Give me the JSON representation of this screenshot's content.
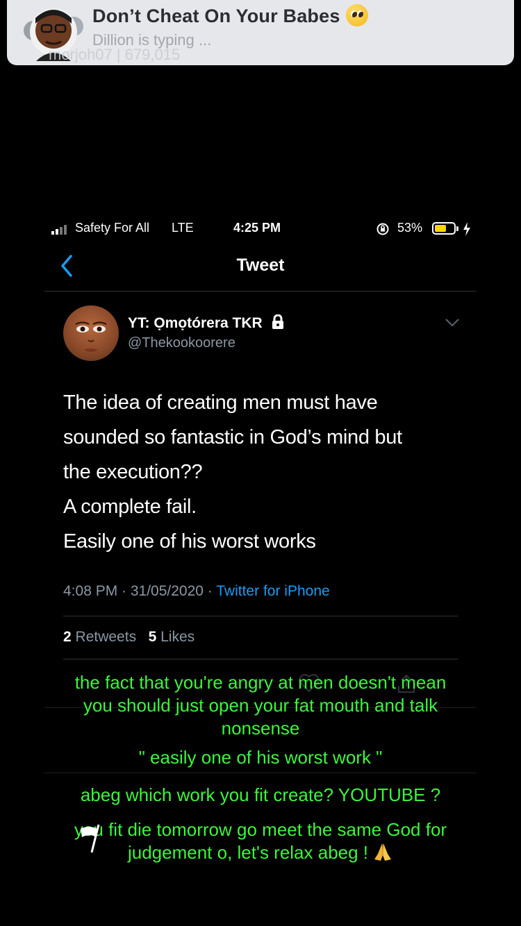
{
  "banner": {
    "title": "Don’t Cheat On Your Babes",
    "title_emoji": "pleading-face-emoji",
    "typing": "Dillion is typing ...",
    "ghost_text": "morjoh07 | 679,015"
  },
  "status_bar": {
    "carrier": "Safety For All",
    "network": "LTE",
    "time": "4:25 PM",
    "battery": "53%",
    "battery_level": 0.53
  },
  "nav": {
    "title": "Tweet"
  },
  "tweet": {
    "display_name": "YT: Ọmọtórera TKR",
    "handle": "@Thekookoorere",
    "lines": [
      "The idea of creating men must have",
      "sounded so fantastic in God’s mind but",
      "the execution??",
      "A complete fail.",
      "Easily one of his worst works"
    ],
    "timestamp": "4:08 PM · 31/05/2020 · ",
    "source": "Twitter for iPhone",
    "retweets_count": "2",
    "retweets_label": "Retweets",
    "likes_count": "5",
    "likes_label": "Likes"
  },
  "captions": {
    "c1": [
      "the fact that you're angry at men doesn't mean",
      "you should just open your fat mouth and talk",
      "nonsense"
    ],
    "c2": "\" easily one of his worst work \"",
    "c3": "abeg which work you fit create? YOUTUBE ?",
    "c4": [
      "you fit die tomorrow go meet the same God for",
      "judgement o, let's relax abeg !"
    ]
  },
  "colors": {
    "caption": "#3cf53c",
    "link": "#1d9bf0",
    "muted": "#8b98a5",
    "battery": "#ffd60a"
  }
}
